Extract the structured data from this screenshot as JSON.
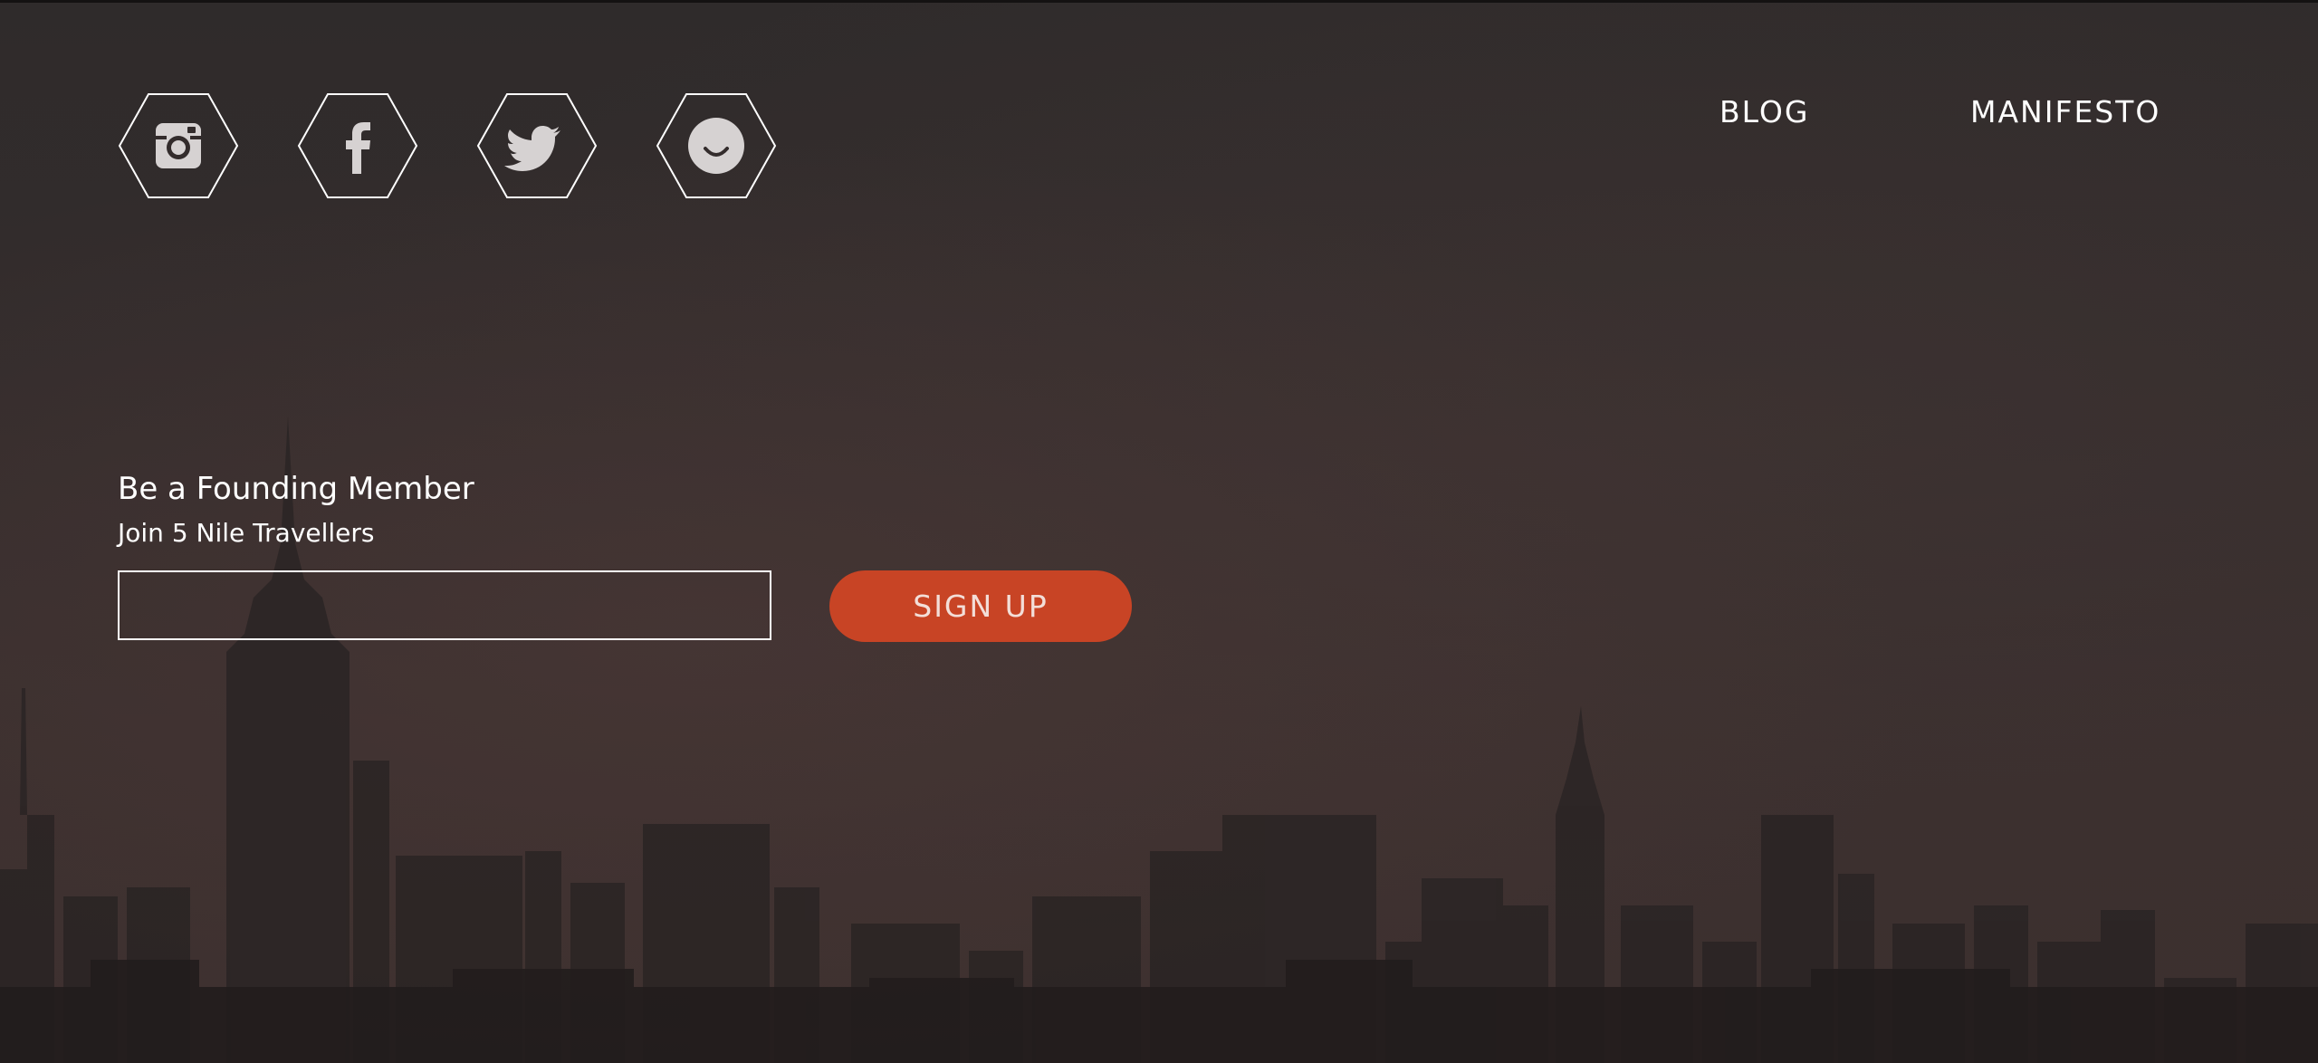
{
  "social": [
    {
      "name": "instagram-icon"
    },
    {
      "name": "facebook-icon"
    },
    {
      "name": "twitter-icon"
    },
    {
      "name": "smiley-icon"
    }
  ],
  "nav": {
    "blog_label": "BLOG",
    "manifesto_label": "MANIFESTO"
  },
  "signup": {
    "title": "Be a Founding Member",
    "subtitle": "Join 5 Nile Travellers",
    "email_value": "",
    "button_label": "SIGN UP"
  },
  "colors": {
    "background": "#332c2c",
    "accent": "#c84425",
    "text": "#ffffff",
    "icon_fill": "#d6d2d2"
  }
}
